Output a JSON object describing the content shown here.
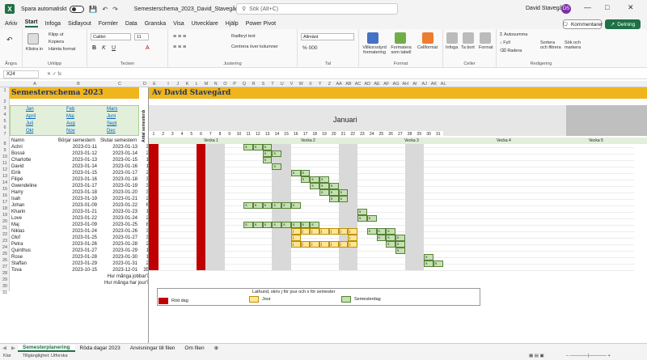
{
  "titlebar": {
    "autosave": "Spara automatiskt",
    "filename": "Semesterschema_2023_David_Stavegård_V1_0.xlsx",
    "search": "Sök (Alt+C)",
    "user": "David Stavegård",
    "initials": "DS"
  },
  "tabs": [
    "Arkiv",
    "Start",
    "Infoga",
    "Sidlayout",
    "Formler",
    "Data",
    "Granska",
    "Visa",
    "Utvecklare",
    "Hjälp",
    "Power Pivot"
  ],
  "active_tab": "Start",
  "comment_btn": "Kommentarer",
  "share_btn": "Delning",
  "ribbon": {
    "groups": [
      "Ångra",
      "Urklipp",
      "Tecken",
      "Justering",
      "Tal",
      "Format",
      "Celler",
      "Redigering"
    ],
    "paste": "Klistra in",
    "cut": "Klipp ut",
    "copy": "Kopiera",
    "format_painter": "Hämta format",
    "font": "Calibri",
    "size": "11",
    "wrap": "Radbryt text",
    "merge": "Centrera över kolumner",
    "numfmt": "Allmänt",
    "cond": "Villkorsstyrd formatering",
    "table": "Formatera som tabell",
    "cellstyle": "Cellformat",
    "insert": "Infoga",
    "delete": "Ta bort",
    "format": "Format",
    "autosum": "Autosumma",
    "fill": "Fyll",
    "clear": "Radera",
    "sort": "Sortera och filtrera",
    "find": "Sök och markera"
  },
  "namebox": "X24",
  "formula": "",
  "col_headers": [
    "A",
    "B",
    "C",
    "D",
    "E",
    "I",
    "J",
    "K",
    "L",
    "M",
    "N",
    "O",
    "P",
    "Q",
    "R",
    "S",
    "T",
    "U",
    "V",
    "W",
    "X",
    "Y",
    "Z",
    "AA",
    "AB",
    "AC",
    "AD",
    "AE",
    "AF",
    "AG",
    "AH",
    "AI",
    "AJ",
    "AK",
    "AL"
  ],
  "sheet": {
    "title": "Semesterschema 2023",
    "subtitle": "Av David Stavegård",
    "months": [
      "Jan",
      "Feb",
      "Mars",
      "April",
      "Maj",
      "Juni",
      "Juli",
      "Aug",
      "Sept",
      "Okt",
      "Nov",
      "Dec"
    ],
    "month_header": "Januari",
    "days_header": "Antal semesterdagar",
    "col_labels": [
      "Namn",
      "Börjar semestern",
      "Slutar semestern"
    ],
    "weeks": [
      "Vecka 1",
      "Vecka 2",
      "Vecka 3",
      "Vecka 4",
      "Vecka 5"
    ],
    "rows": [
      [
        "Achri",
        "2023-01-11",
        "2023-01-13",
        "3"
      ],
      [
        "Bossé",
        "2023-01-12",
        "2023-01-14",
        "2"
      ],
      [
        "Charlotte",
        "2023-01-13",
        "2023-01-15",
        "1"
      ],
      [
        "David",
        "2023-01-14",
        "2023-01-16",
        "1"
      ],
      [
        "Eirik",
        "2023-01-15",
        "2023-01-17",
        "2"
      ],
      [
        "Filipé",
        "2023-01-16",
        "2023-01-18",
        "3"
      ],
      [
        "Gwendeline",
        "2023-01-17",
        "2023-01-19",
        "3"
      ],
      [
        "Harry",
        "2023-01-18",
        "2023-01-20",
        "3"
      ],
      [
        "Isah",
        "2023-01-19",
        "2023-01-21",
        "2"
      ],
      [
        "Johan",
        "2023-01-09",
        "2023-01-22",
        "6"
      ],
      [
        "Kharin",
        "2023-01-21",
        "2023-01-23",
        "1"
      ],
      [
        "Love",
        "2023-01-22",
        "2023-01-24",
        "2"
      ],
      [
        "Maj",
        "2023-01-09",
        "2023-01-25",
        "8"
      ],
      [
        "Niklas",
        "2023-01-24",
        "2023-01-26",
        "3"
      ],
      [
        "Olof",
        "2023-01-25",
        "2023-01-27",
        "3"
      ],
      [
        "Petra",
        "2023-01-26",
        "2023-01-28",
        "2"
      ],
      [
        "Quinthus",
        "2023-01-27",
        "2023-01-29",
        "1"
      ],
      [
        "Rose",
        "2023-01-28",
        "2023-01-30",
        "1"
      ],
      [
        "Staffan",
        "2023-01-29",
        "2023-01-31",
        "2"
      ],
      [
        "Tova",
        "2023-10-15",
        "2023-12-01",
        "35"
      ]
    ],
    "q_work": "Hur många jobbar?",
    "q_vac": "Hur många har jour?",
    "legend_title": "Lathund, skriv j för jour och s för semester",
    "legend_red": "Röd dag",
    "legend_jour": "Jour",
    "legend_sem": "Semesterdag",
    "jour_mark": "j",
    "sem_mark": "s"
  },
  "sheettabs": [
    "Semesterplanering",
    "Röda dagar 2023",
    "Anvisningar till filen",
    "Om filen"
  ],
  "status": [
    "Klar",
    "Tillgänglighet: Utforska"
  ],
  "colors": {
    "title_bg": "#f0b41c",
    "month_bg": "#e7e6e6",
    "green": "#c6e0b4",
    "red": "#c00000",
    "yellow": "#ffe699",
    "weekend": "#d9d9d9",
    "accent": "#1e7145"
  }
}
